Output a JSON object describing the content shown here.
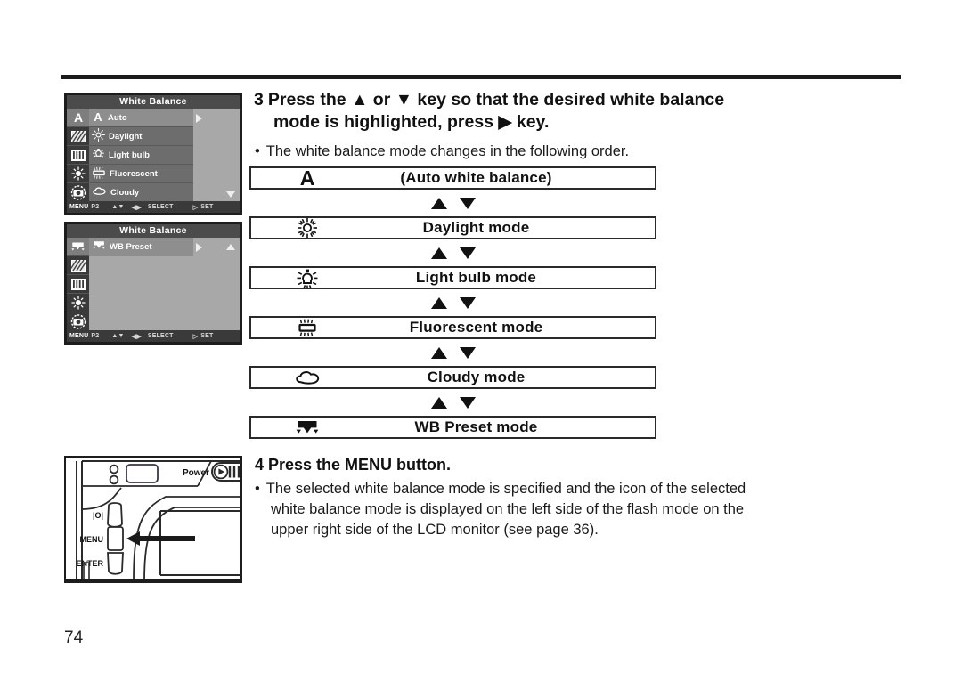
{
  "page": {
    "number": "74"
  },
  "lcd_screens": [
    {
      "title": "White Balance",
      "icon_strip": [
        "A",
        "gradient-icon",
        "bars-icon",
        "sun-small-icon",
        "camera-icon"
      ],
      "rows": [
        {
          "label": "Auto",
          "icon": "letter-a-icon",
          "selected": true
        },
        {
          "label": "Daylight",
          "icon": "sun-icon",
          "selected": false
        },
        {
          "label": "Light bulb",
          "icon": "bulb-icon",
          "selected": false
        },
        {
          "label": "Fluorescent",
          "icon": "fluorescent-icon",
          "selected": false
        },
        {
          "label": "Cloudy",
          "icon": "cloud-icon",
          "selected": false
        }
      ],
      "right_pane": {
        "caret_right": true,
        "caret_down": true,
        "caret_up": false
      },
      "status": {
        "menu": "MENU",
        "page": "P2",
        "updown": "▲▼",
        "leftright": "◀▶",
        "select": "SELECT",
        "set_caret": "▷",
        "set": "SET"
      }
    },
    {
      "title": "White Balance",
      "icon_strip": [
        "wb-preset-icon",
        "gradient-icon",
        "bars-icon",
        "sun-small-icon",
        "camera-icon"
      ],
      "rows": [
        {
          "label": "WB Preset",
          "icon": "wb-preset-icon",
          "selected": true
        },
        {
          "label": "",
          "icon": "",
          "selected": false
        },
        {
          "label": "",
          "icon": "",
          "selected": false
        },
        {
          "label": "",
          "icon": "",
          "selected": false
        },
        {
          "label": "",
          "icon": "",
          "selected": false
        }
      ],
      "right_pane": {
        "caret_right": true,
        "caret_down": false,
        "caret_up": true
      },
      "status": {
        "menu": "MENU",
        "page": "P2",
        "updown": "▲▼",
        "leftright": "◀▶",
        "select": "SELECT",
        "set_caret": "▷",
        "set": "SET"
      }
    }
  ],
  "step3": {
    "number": "3",
    "line1": "Press the ▲  or ▼  key so that the desired white balance",
    "line2": "mode is highlighted, press ▶ key.",
    "bullet": "The white balance mode changes in the following order.",
    "bullet_marker": "•"
  },
  "mode_flow": {
    "arrow_up": "▲",
    "arrow_down": "▼",
    "items": [
      {
        "icon": "letter-a-icon",
        "label": "(Auto white balance)"
      },
      {
        "icon": "sun-icon",
        "label": "Daylight  mode"
      },
      {
        "icon": "bulb-icon",
        "label": "Light bulb mode"
      },
      {
        "icon": "fluorescent-icon",
        "label": "Fluorescent mode"
      },
      {
        "icon": "cloud-icon",
        "label": "Cloudy mode"
      },
      {
        "icon": "wb-preset-icon",
        "label": "WB Preset mode"
      }
    ]
  },
  "step4": {
    "number": "4",
    "heading": "Press the MENU button.",
    "bullet_marker": "•",
    "bullet_line1": "The selected white balance mode is specified and the icon of the selected",
    "bullet_line2": "white balance mode is displayed on the left side of the flash mode on the",
    "bullet_line3": "upper right side of the LCD monitor (see page 36)."
  },
  "camera": {
    "power_label": "Power",
    "display_button_label": "□│□",
    "menu_button_label": "MENU",
    "enter_button_label": "ENTER"
  },
  "colors": {
    "ink": "#1a1a1a",
    "lcd_bg": "#2b2b2b",
    "lcd_title_bg": "#4b4b4b",
    "lcd_list_bg": "#6d6d6d",
    "lcd_selected_bg": "#8e8e8e",
    "lcd_right_bg": "#a8a8a8"
  }
}
